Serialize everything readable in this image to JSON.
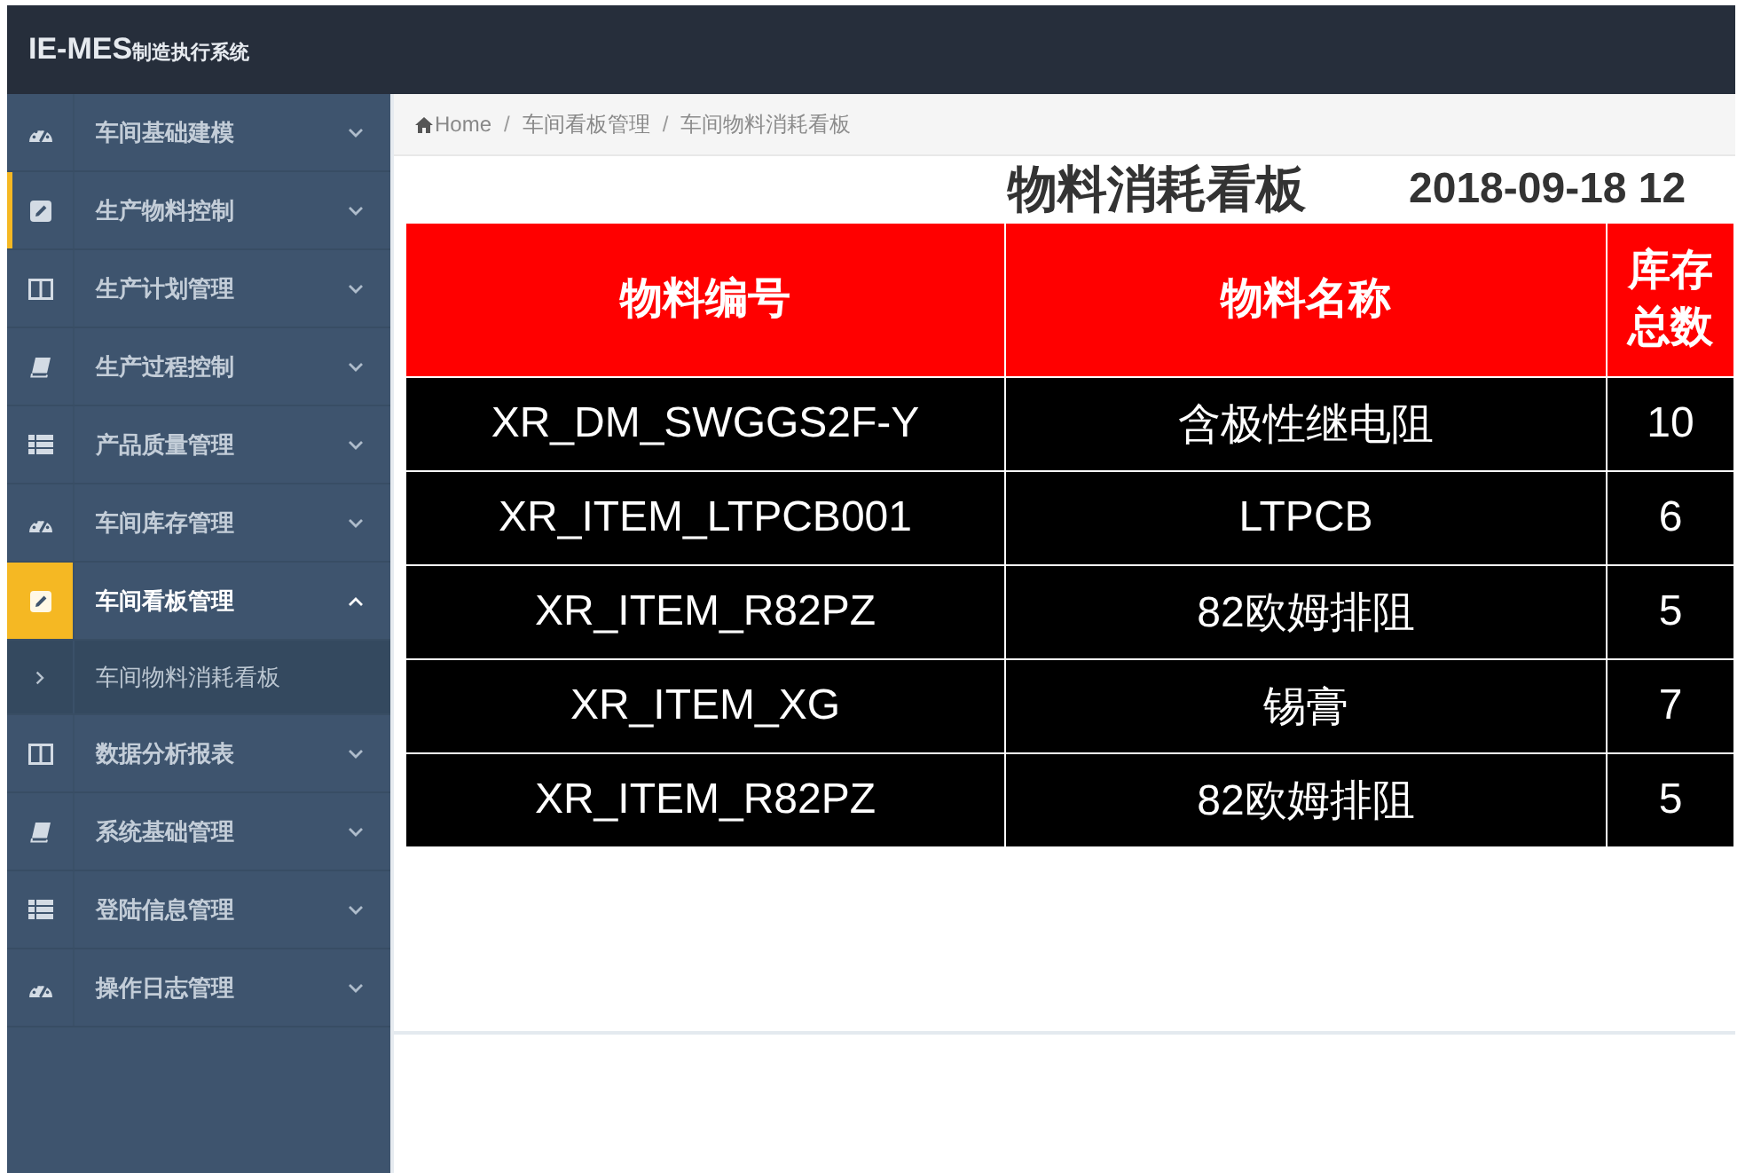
{
  "header": {
    "title": "IE-MES",
    "subtitle": "制造执行系统"
  },
  "sidebar": {
    "items": [
      {
        "label": "车间基础建模",
        "selected": false,
        "hovered": false,
        "expanded": false
      },
      {
        "label": "生产物料控制",
        "selected": false,
        "hovered": true,
        "expanded": false
      },
      {
        "label": "生产计划管理",
        "selected": false,
        "hovered": false,
        "expanded": false
      },
      {
        "label": "生产过程控制",
        "selected": false,
        "hovered": false,
        "expanded": false
      },
      {
        "label": "产品质量管理",
        "selected": false,
        "hovered": false,
        "expanded": false
      },
      {
        "label": "车间库存管理",
        "selected": false,
        "hovered": false,
        "expanded": false
      },
      {
        "label": "车间看板管理",
        "selected": true,
        "hovered": false,
        "expanded": true,
        "children": [
          {
            "label": "车间物料消耗看板"
          }
        ]
      },
      {
        "label": "数据分析报表",
        "selected": false,
        "hovered": false,
        "expanded": false
      },
      {
        "label": "系统基础管理",
        "selected": false,
        "hovered": false,
        "expanded": false
      },
      {
        "label": "登陆信息管理",
        "selected": false,
        "hovered": false,
        "expanded": false
      },
      {
        "label": "操作日志管理",
        "selected": false,
        "hovered": false,
        "expanded": false
      }
    ]
  },
  "breadcrumb": {
    "separator": "/",
    "items": [
      {
        "label": "Home"
      },
      {
        "label": "车间看板管理"
      },
      {
        "label": "车间物料消耗看板"
      }
    ]
  },
  "board": {
    "title": "物料消耗看板",
    "datetime": "2018-09-18 12"
  },
  "table": {
    "columns": [
      "物料编号",
      "物料名称",
      "库存总数"
    ],
    "rows": [
      [
        "XR_DM_SWGGS2F-Y",
        "含极性继电阻",
        "10"
      ],
      [
        "XR_ITEM_LTPCB001",
        "LTPCB",
        "6"
      ],
      [
        "XR_ITEM_R82PZ",
        "82欧姆排阻",
        "5"
      ],
      [
        "XR_ITEM_XG",
        "锡膏",
        "7"
      ],
      [
        "XR_ITEM_R82PZ",
        "82欧姆排阻",
        "5"
      ]
    ]
  }
}
